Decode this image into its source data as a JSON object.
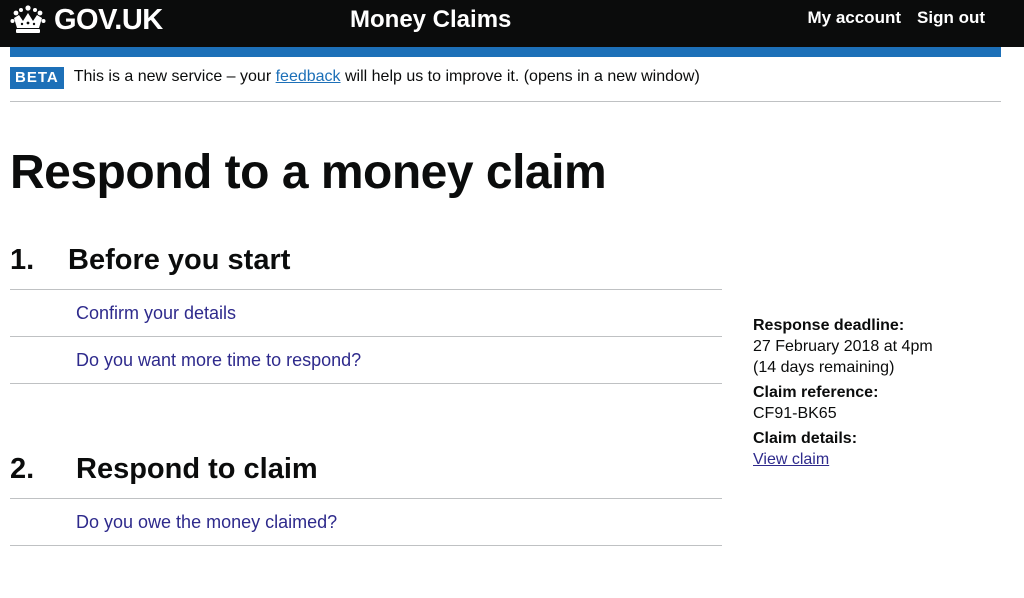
{
  "header": {
    "logo_text": "GOV.UK",
    "service_name": "Money Claims",
    "nav": [
      "My account",
      "Sign out"
    ]
  },
  "phase_banner": {
    "tag": "BETA",
    "text_before": "This is a new service – your ",
    "link_text": "feedback",
    "text_after": " will help us to improve it. (opens in a new window)"
  },
  "page_title": "Respond to a money claim",
  "sections": [
    {
      "number": "1.",
      "title": "Before you start",
      "tasks": [
        "Confirm your details",
        "Do you want more time to respond?"
      ]
    },
    {
      "number": "2.",
      "title": "Respond to claim",
      "tasks": [
        "Do you owe the money claimed?"
      ]
    }
  ],
  "aside": {
    "deadline_label": "Response deadline:",
    "deadline_value": "27 February 2018 at 4pm",
    "deadline_remaining": "(14 days remaining)",
    "reference_label": "Claim reference:",
    "reference_value": "CF91-BK65",
    "details_label": "Claim details:",
    "details_link": "View claim"
  },
  "colors": {
    "header_bg": "#0b0c0c",
    "blue_bar": "#1d70b8",
    "link": "#2e2a8c",
    "border": "#bfc1c3"
  }
}
